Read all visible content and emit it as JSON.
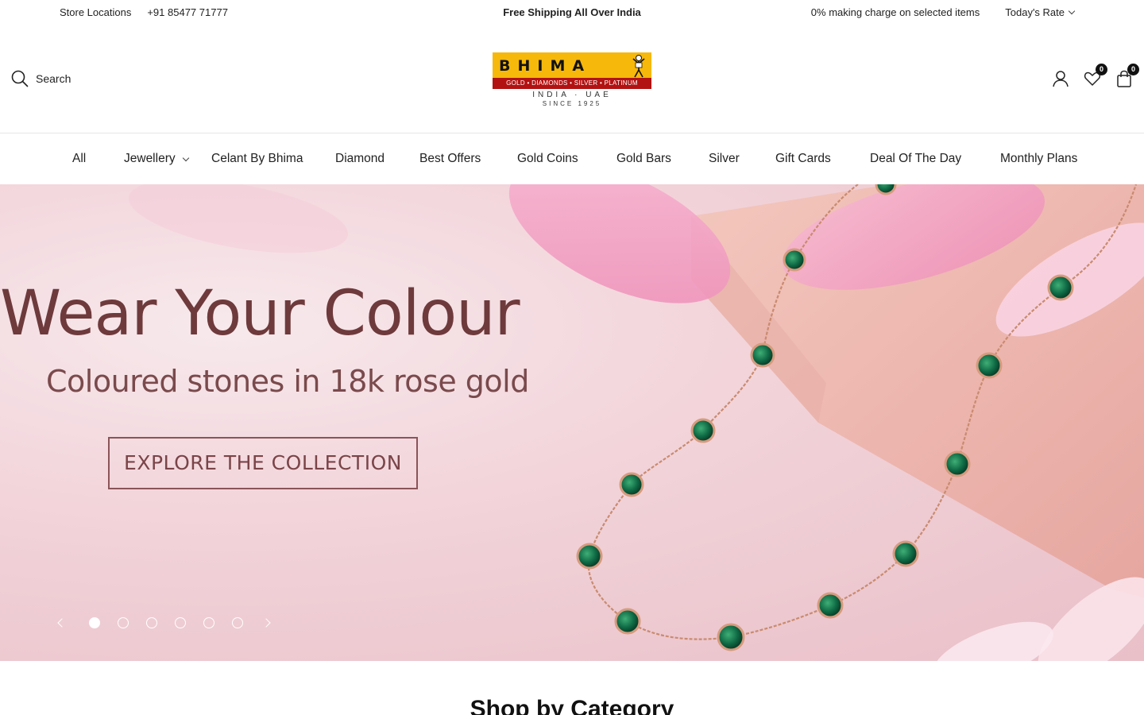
{
  "topbar": {
    "store_locations": "Store Locations",
    "phone": "+91 85477 71777",
    "shipping": "Free Shipping All Over India",
    "making_charge": "0% making charge on selected items",
    "todays_rate": "Today's Rate"
  },
  "header": {
    "search_label": "Search",
    "logo": {
      "wordmark": "BHIMA",
      "strip": "GOLD • DIAMONDS • SILVER • PLATINUM",
      "regions": "INDIA · UAE",
      "since": "SINCE 1925"
    },
    "wishlist_count": "0",
    "cart_count": "0"
  },
  "nav": {
    "items": [
      {
        "label": "All"
      },
      {
        "label": "Jewellery"
      },
      {
        "label": "Celant By Bhima"
      },
      {
        "label": "Diamond"
      },
      {
        "label": "Best Offers"
      },
      {
        "label": "Gold Coins"
      },
      {
        "label": "Gold Bars"
      },
      {
        "label": "Silver"
      },
      {
        "label": "Gift Cards"
      },
      {
        "label": "Deal Of The Day"
      },
      {
        "label": "Monthly Plans"
      }
    ]
  },
  "hero": {
    "title": "Wear Your Colour",
    "subtitle": "Coloured stones in 18k rose gold",
    "cta": "EXPLORE THE COLLECTION",
    "slide_count": 6,
    "active_slide": 1
  },
  "sections": {
    "shop_by_category": "Shop by Category"
  },
  "colors": {
    "hero_text": "#6e3a3c",
    "logo_yellow": "#f6b80a",
    "logo_red": "#b31212",
    "emerald": "#0f6b45",
    "rose_gold": "#c98b6f"
  }
}
